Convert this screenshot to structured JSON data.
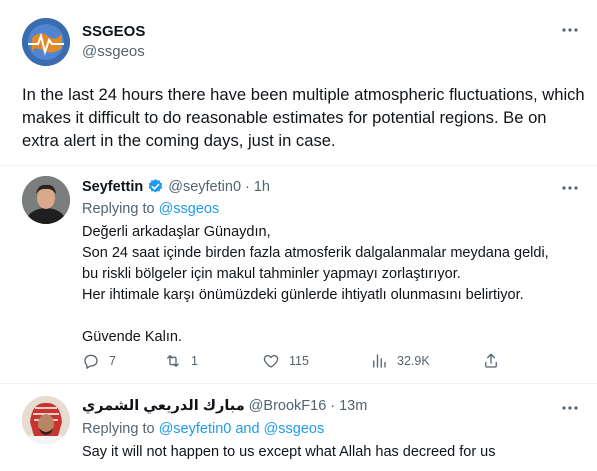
{
  "main_tweet": {
    "display_name": "SSGEOS",
    "handle": "@ssgeos",
    "text": "In the last 24 hours there have been multiple atmospheric fluctuations, which makes it difficult to do reasonable estimates for potential regions. Be on extra alert in the coming days, just in case."
  },
  "replies": [
    {
      "display_name": "Seyfettin",
      "handle": "@seyfetin0",
      "separator": "·",
      "time": "1h",
      "replying_prefix": "Replying to",
      "replying_to": "@ssgeos",
      "lines": [
        "Değerli arkadaşlar Günaydın,",
        "Son 24 saat içinde birden fazla atmosferik dalgalanmalar meydana geldi,",
        "bu riskli bölgeler için makul tahminler yapmayı zorlaştırıyor.",
        "Her ihtimale karşı önümüzdeki günlerde ihtiyatlı olunmasını belirtiyor.",
        "",
        "Güvende Kalın."
      ],
      "stats": {
        "replies": "7",
        "retweets": "1",
        "likes": "115",
        "views": "32.9K"
      }
    },
    {
      "display_name": "مبارك الدريعي الشمري",
      "handle": "@BrookF16",
      "separator": "·",
      "time": "13m",
      "replying_prefix": "Replying to",
      "replying_to": "@seyfetin0 and @ssgeos",
      "lines": [
        "Say it will not happen to us except what Allah has decreed for us"
      ]
    }
  ],
  "icons": {
    "more": "more-dots-icon",
    "verified": "verified-badge-icon",
    "reply": "reply-icon",
    "retweet": "retweet-icon",
    "like": "heart-icon",
    "views": "views-chart-icon",
    "share": "share-icon"
  },
  "colors": {
    "accent": "#1d9bf0",
    "secondary_text": "#536471",
    "primary_text": "#0f1419",
    "divider": "#eff3f4"
  }
}
